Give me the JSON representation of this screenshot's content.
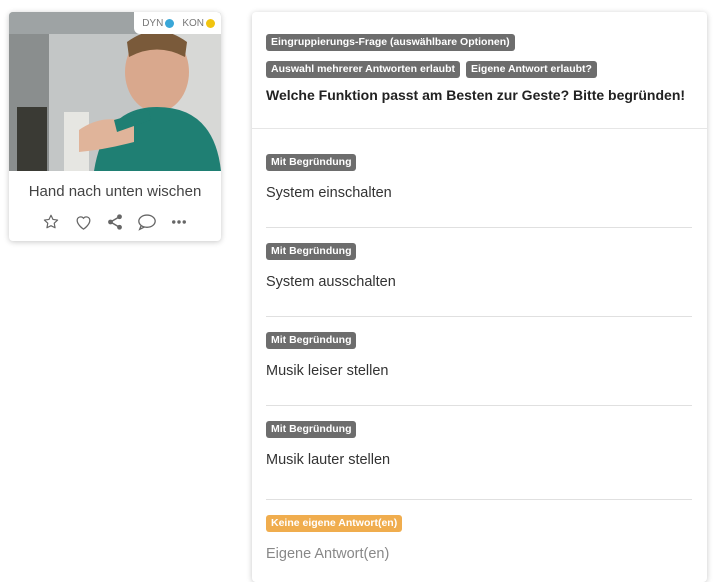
{
  "gesture_card": {
    "tag_dyn": "DYN",
    "tag_kon": "KON",
    "tag_dyn_color": "#3aa7d8",
    "tag_kon_color": "#f1c40f",
    "title": "Hand nach unten wischen",
    "actions": [
      "star-icon",
      "heart-icon",
      "share-icon",
      "comment-icon",
      "more-icon"
    ]
  },
  "question": {
    "type_badge": "Eingruppierungs-Frage (auswählbare Optionen)",
    "multi_badge": "Auswahl mehrerer Antworten erlaubt",
    "own_answer_badge": "Eigene Antwort erlaubt?",
    "text": "Welche Funktion passt am Besten zur Geste? Bitte begründen!"
  },
  "options": [
    {
      "badge": "Mit Begründung",
      "label": "System einschalten"
    },
    {
      "badge": "Mit Begründung",
      "label": "System ausschalten"
    },
    {
      "badge": "Mit Begründung",
      "label": "Musik leiser stellen"
    },
    {
      "badge": "Mit Begründung",
      "label": "Musik lauter stellen"
    }
  ],
  "own_answer": {
    "badge": "Keine eigene Antwort(en)",
    "placeholder": "Eigene Antwort(en)"
  }
}
